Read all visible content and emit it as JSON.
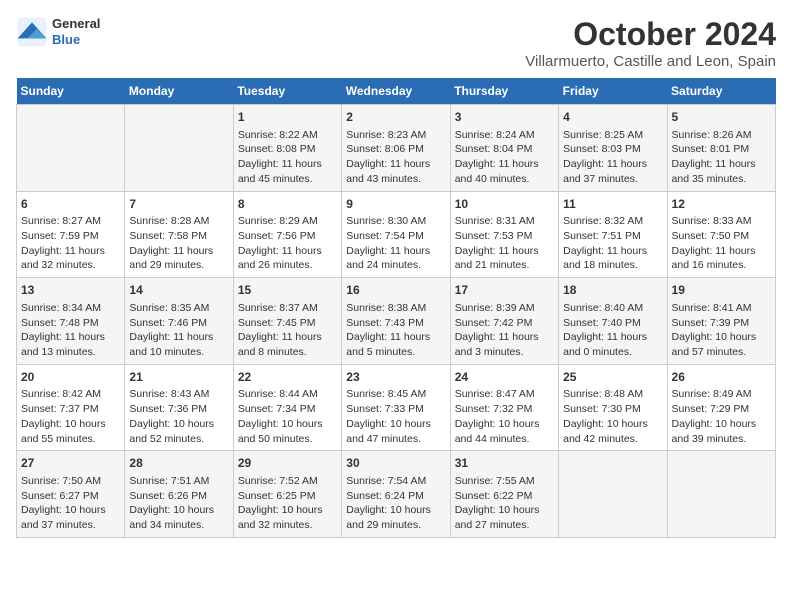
{
  "header": {
    "logo_general": "General",
    "logo_blue": "Blue",
    "month_title": "October 2024",
    "location": "Villarmuerto, Castille and Leon, Spain"
  },
  "days_of_week": [
    "Sunday",
    "Monday",
    "Tuesday",
    "Wednesday",
    "Thursday",
    "Friday",
    "Saturday"
  ],
  "weeks": [
    [
      {
        "day": "",
        "info": ""
      },
      {
        "day": "",
        "info": ""
      },
      {
        "day": "1",
        "sunrise": "8:22 AM",
        "sunset": "8:08 PM",
        "daylight": "11 hours and 45 minutes."
      },
      {
        "day": "2",
        "sunrise": "8:23 AM",
        "sunset": "8:06 PM",
        "daylight": "11 hours and 43 minutes."
      },
      {
        "day": "3",
        "sunrise": "8:24 AM",
        "sunset": "8:04 PM",
        "daylight": "11 hours and 40 minutes."
      },
      {
        "day": "4",
        "sunrise": "8:25 AM",
        "sunset": "8:03 PM",
        "daylight": "11 hours and 37 minutes."
      },
      {
        "day": "5",
        "sunrise": "8:26 AM",
        "sunset": "8:01 PM",
        "daylight": "11 hours and 35 minutes."
      }
    ],
    [
      {
        "day": "6",
        "sunrise": "8:27 AM",
        "sunset": "7:59 PM",
        "daylight": "11 hours and 32 minutes."
      },
      {
        "day": "7",
        "sunrise": "8:28 AM",
        "sunset": "7:58 PM",
        "daylight": "11 hours and 29 minutes."
      },
      {
        "day": "8",
        "sunrise": "8:29 AM",
        "sunset": "7:56 PM",
        "daylight": "11 hours and 26 minutes."
      },
      {
        "day": "9",
        "sunrise": "8:30 AM",
        "sunset": "7:54 PM",
        "daylight": "11 hours and 24 minutes."
      },
      {
        "day": "10",
        "sunrise": "8:31 AM",
        "sunset": "7:53 PM",
        "daylight": "11 hours and 21 minutes."
      },
      {
        "day": "11",
        "sunrise": "8:32 AM",
        "sunset": "7:51 PM",
        "daylight": "11 hours and 18 minutes."
      },
      {
        "day": "12",
        "sunrise": "8:33 AM",
        "sunset": "7:50 PM",
        "daylight": "11 hours and 16 minutes."
      }
    ],
    [
      {
        "day": "13",
        "sunrise": "8:34 AM",
        "sunset": "7:48 PM",
        "daylight": "11 hours and 13 minutes."
      },
      {
        "day": "14",
        "sunrise": "8:35 AM",
        "sunset": "7:46 PM",
        "daylight": "11 hours and 10 minutes."
      },
      {
        "day": "15",
        "sunrise": "8:37 AM",
        "sunset": "7:45 PM",
        "daylight": "11 hours and 8 minutes."
      },
      {
        "day": "16",
        "sunrise": "8:38 AM",
        "sunset": "7:43 PM",
        "daylight": "11 hours and 5 minutes."
      },
      {
        "day": "17",
        "sunrise": "8:39 AM",
        "sunset": "7:42 PM",
        "daylight": "11 hours and 3 minutes."
      },
      {
        "day": "18",
        "sunrise": "8:40 AM",
        "sunset": "7:40 PM",
        "daylight": "11 hours and 0 minutes."
      },
      {
        "day": "19",
        "sunrise": "8:41 AM",
        "sunset": "7:39 PM",
        "daylight": "10 hours and 57 minutes."
      }
    ],
    [
      {
        "day": "20",
        "sunrise": "8:42 AM",
        "sunset": "7:37 PM",
        "daylight": "10 hours and 55 minutes."
      },
      {
        "day": "21",
        "sunrise": "8:43 AM",
        "sunset": "7:36 PM",
        "daylight": "10 hours and 52 minutes."
      },
      {
        "day": "22",
        "sunrise": "8:44 AM",
        "sunset": "7:34 PM",
        "daylight": "10 hours and 50 minutes."
      },
      {
        "day": "23",
        "sunrise": "8:45 AM",
        "sunset": "7:33 PM",
        "daylight": "10 hours and 47 minutes."
      },
      {
        "day": "24",
        "sunrise": "8:47 AM",
        "sunset": "7:32 PM",
        "daylight": "10 hours and 44 minutes."
      },
      {
        "day": "25",
        "sunrise": "8:48 AM",
        "sunset": "7:30 PM",
        "daylight": "10 hours and 42 minutes."
      },
      {
        "day": "26",
        "sunrise": "8:49 AM",
        "sunset": "7:29 PM",
        "daylight": "10 hours and 39 minutes."
      }
    ],
    [
      {
        "day": "27",
        "sunrise": "7:50 AM",
        "sunset": "6:27 PM",
        "daylight": "10 hours and 37 minutes."
      },
      {
        "day": "28",
        "sunrise": "7:51 AM",
        "sunset": "6:26 PM",
        "daylight": "10 hours and 34 minutes."
      },
      {
        "day": "29",
        "sunrise": "7:52 AM",
        "sunset": "6:25 PM",
        "daylight": "10 hours and 32 minutes."
      },
      {
        "day": "30",
        "sunrise": "7:54 AM",
        "sunset": "6:24 PM",
        "daylight": "10 hours and 29 minutes."
      },
      {
        "day": "31",
        "sunrise": "7:55 AM",
        "sunset": "6:22 PM",
        "daylight": "10 hours and 27 minutes."
      },
      {
        "day": "",
        "info": ""
      },
      {
        "day": "",
        "info": ""
      }
    ]
  ]
}
